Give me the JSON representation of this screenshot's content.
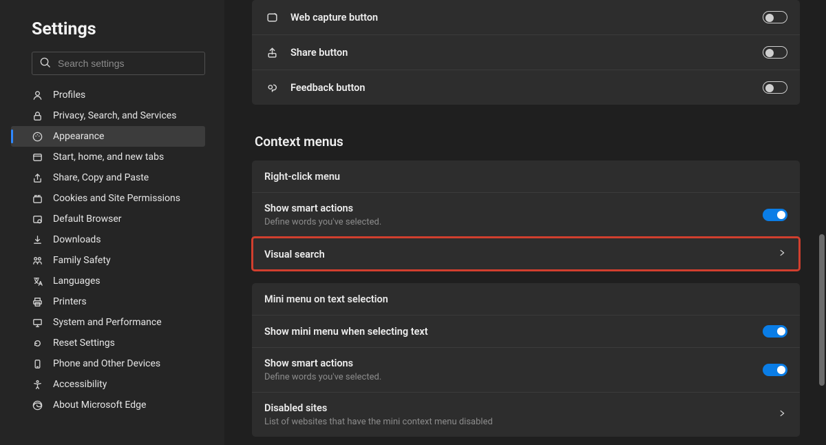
{
  "sidebar": {
    "title": "Settings",
    "search_placeholder": "Search settings",
    "items": [
      {
        "label": "Profiles",
        "icon": "profile-icon"
      },
      {
        "label": "Privacy, Search, and Services",
        "icon": "lock-icon"
      },
      {
        "label": "Appearance",
        "icon": "palette-icon",
        "active": true
      },
      {
        "label": "Start, home, and new tabs",
        "icon": "tabs-icon"
      },
      {
        "label": "Share, Copy and Paste",
        "icon": "share-icon"
      },
      {
        "label": "Cookies and Site Permissions",
        "icon": "cookies-icon"
      },
      {
        "label": "Default Browser",
        "icon": "browser-icon"
      },
      {
        "label": "Downloads",
        "icon": "download-icon"
      },
      {
        "label": "Family Safety",
        "icon": "family-icon"
      },
      {
        "label": "Languages",
        "icon": "language-icon"
      },
      {
        "label": "Printers",
        "icon": "printer-icon"
      },
      {
        "label": "System and Performance",
        "icon": "system-icon"
      },
      {
        "label": "Reset Settings",
        "icon": "reset-icon"
      },
      {
        "label": "Phone and Other Devices",
        "icon": "phone-icon"
      },
      {
        "label": "Accessibility",
        "icon": "accessibility-icon"
      },
      {
        "label": "About Microsoft Edge",
        "icon": "edge-icon"
      }
    ]
  },
  "toolbar_rows": [
    {
      "label": "Web capture button",
      "icon": "capture-icon",
      "on": false
    },
    {
      "label": "Share button",
      "icon": "share2-icon",
      "on": false
    },
    {
      "label": "Feedback button",
      "icon": "feedback-icon",
      "on": false
    }
  ],
  "context_section": {
    "heading": "Context menus",
    "card1": {
      "header": "Right-click menu",
      "row1": {
        "title": "Show smart actions",
        "sub": "Define words you've selected.",
        "on": true
      },
      "row2": {
        "title": "Visual search"
      }
    },
    "card2": {
      "header": "Mini menu on text selection",
      "row1": {
        "title": "Show mini menu when selecting text",
        "on": true
      },
      "row2": {
        "title": "Show smart actions",
        "sub": "Define words you've selected.",
        "on": true
      },
      "row3": {
        "title": "Disabled sites",
        "sub": "List of websites that have the mini context menu disabled"
      }
    }
  }
}
